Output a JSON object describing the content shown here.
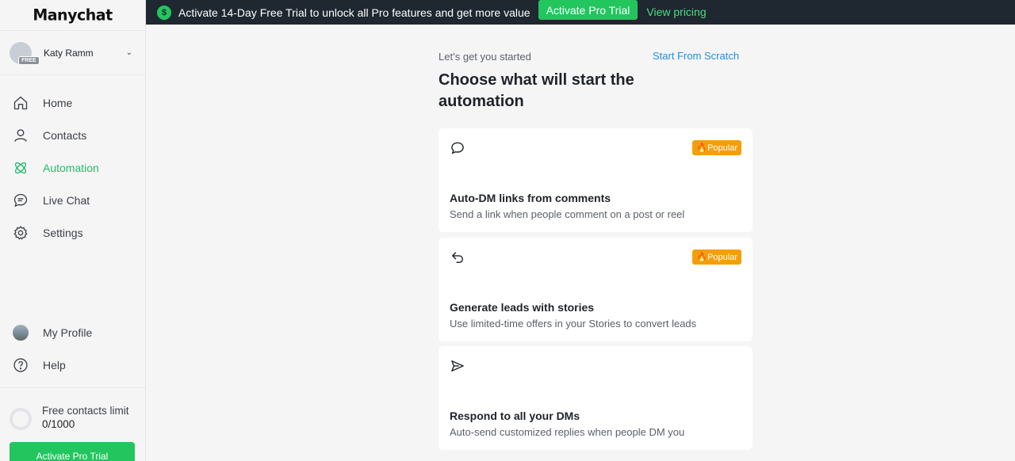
{
  "brand": {
    "logo": "Manychat"
  },
  "account": {
    "name": "Katy Ramm",
    "plan_badge": "FREE"
  },
  "nav": {
    "home": "Home",
    "contacts": "Contacts",
    "automation": "Automation",
    "live_chat": "Live Chat",
    "settings": "Settings",
    "my_profile": "My Profile",
    "help": "Help"
  },
  "limit": {
    "label": "Free contacts limit",
    "count": "0/1000",
    "button": "Activate Pro Trial"
  },
  "banner": {
    "icon_glyph": "$",
    "message": "Activate 14-Day Free Trial to unlock all Pro features and get more value",
    "trial_button": "Activate Pro Trial",
    "pricing_link": "View pricing"
  },
  "main": {
    "subtitle": "Let’s get you started",
    "scratch_link": "Start From Scratch",
    "title": "Choose what will start the automation",
    "cards": [
      {
        "icon": "comment-icon",
        "badge": "Popular",
        "title": "Auto-DM links from comments",
        "description": "Send a link when people comment on a post or reel"
      },
      {
        "icon": "story-reply-icon",
        "badge": "Popular",
        "title": "Generate leads with stories",
        "description": "Use limited-time offers in your Stories to convert leads"
      },
      {
        "icon": "send-icon",
        "title": "Respond to all your DMs",
        "description": "Auto-send customized replies when people DM you"
      }
    ]
  },
  "colors": {
    "accent_green": "#22c55e",
    "link_blue": "#1d8fe0",
    "badge_orange": "#f59e0b",
    "banner_bg": "#1f2730"
  }
}
